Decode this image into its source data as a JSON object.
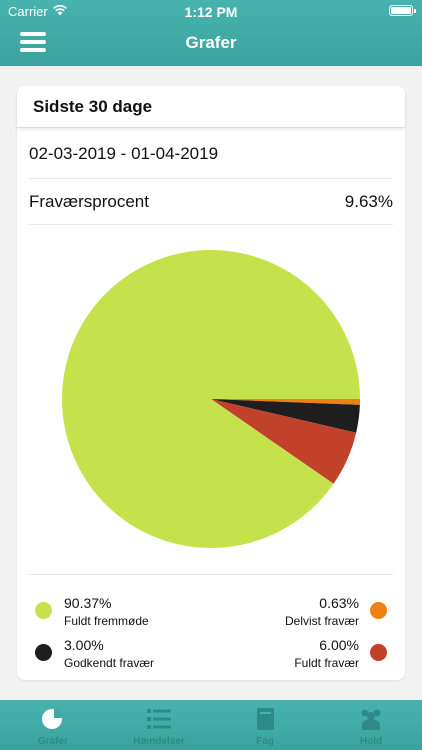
{
  "status_bar": {
    "carrier": "Carrier",
    "time": "1:12 PM"
  },
  "header": {
    "title": "Grafer",
    "menu_icon": "hamburger-menu-icon"
  },
  "card": {
    "title": "Sidste 30 dage",
    "date_range": "02-03-2019 - 01-04-2019",
    "absence_label": "Fraværsprocent",
    "absence_value": "9.63%"
  },
  "chart_data": {
    "type": "pie",
    "slices": [
      {
        "name": "Fuldt fremmøde",
        "value": 90.37,
        "label": "90.37%",
        "color": "#c5e14b"
      },
      {
        "name": "Delvist fravær",
        "value": 0.63,
        "label": "0.63%",
        "color": "#f07f14"
      },
      {
        "name": "Godkendt fravær",
        "value": 3.0,
        "label": "3.00%",
        "color": "#1e1e1e"
      },
      {
        "name": "Fuldt fravær",
        "value": 6.0,
        "label": "6.00%",
        "color": "#c1412a"
      }
    ]
  },
  "tabs": [
    {
      "label": "Grafer",
      "icon": "pie-chart-icon",
      "active": true
    },
    {
      "label": "Hændelser",
      "icon": "list-icon",
      "active": false
    },
    {
      "label": "Fag",
      "icon": "book-icon",
      "active": false
    },
    {
      "label": "Hold",
      "icon": "group-icon",
      "active": false
    }
  ],
  "colors": {
    "primary": "#3fa9a4",
    "background": "#f2f2f2"
  }
}
